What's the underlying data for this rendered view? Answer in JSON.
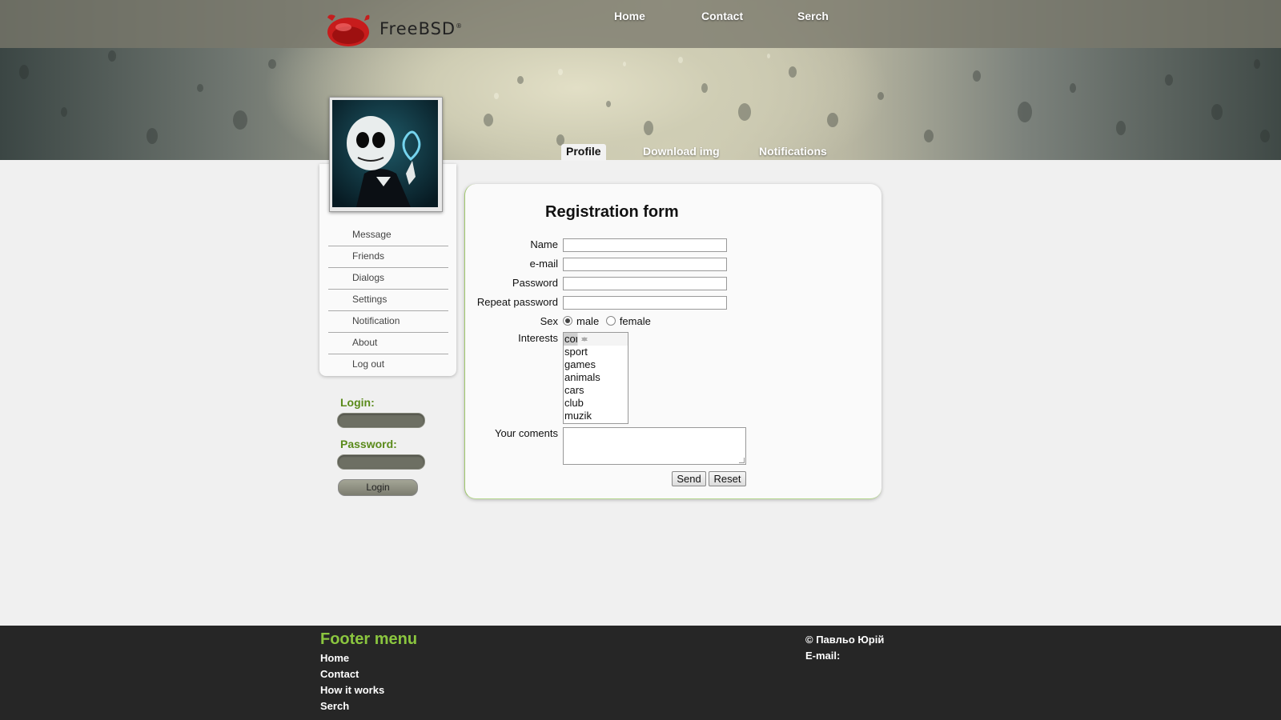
{
  "header": {
    "logo_text": "FreeBSD",
    "nav": [
      "Home",
      "Contact",
      "Serch"
    ],
    "tabs": [
      "Profile",
      "Download img",
      "Notifications"
    ],
    "active_tab": "Profile"
  },
  "sidebar": {
    "menu": [
      "Message",
      "Friends",
      "Dialogs",
      "Settings",
      "Notification",
      "About",
      "Log out"
    ],
    "login": {
      "login_label": "Login:",
      "password_label": "Password:",
      "button": "Login"
    }
  },
  "form": {
    "title": "Registration form",
    "fields": {
      "name": "Name",
      "email": "e-mail",
      "password": "Password",
      "repeat": "Repeat password"
    },
    "sex_label": "Sex",
    "sex_options": [
      "male",
      "female"
    ],
    "sex_selected": "male",
    "interests_label": "Interests",
    "interests": [
      "computers",
      "sport",
      "games",
      "animals",
      "cars",
      "club",
      "muzik"
    ],
    "interests_selected": "computers",
    "comments_label": "Your coments",
    "send": "Send",
    "reset": "Reset"
  },
  "footer": {
    "title": "Footer menu",
    "links": [
      "Home",
      "Contact",
      "How it works",
      "Serch"
    ],
    "copyright": "© Павльо Юрій",
    "email": "E-mail:"
  },
  "colors": {
    "accent_green": "#8bc63f",
    "login_green": "#5a8a1a",
    "footer_bg": "#262626"
  }
}
